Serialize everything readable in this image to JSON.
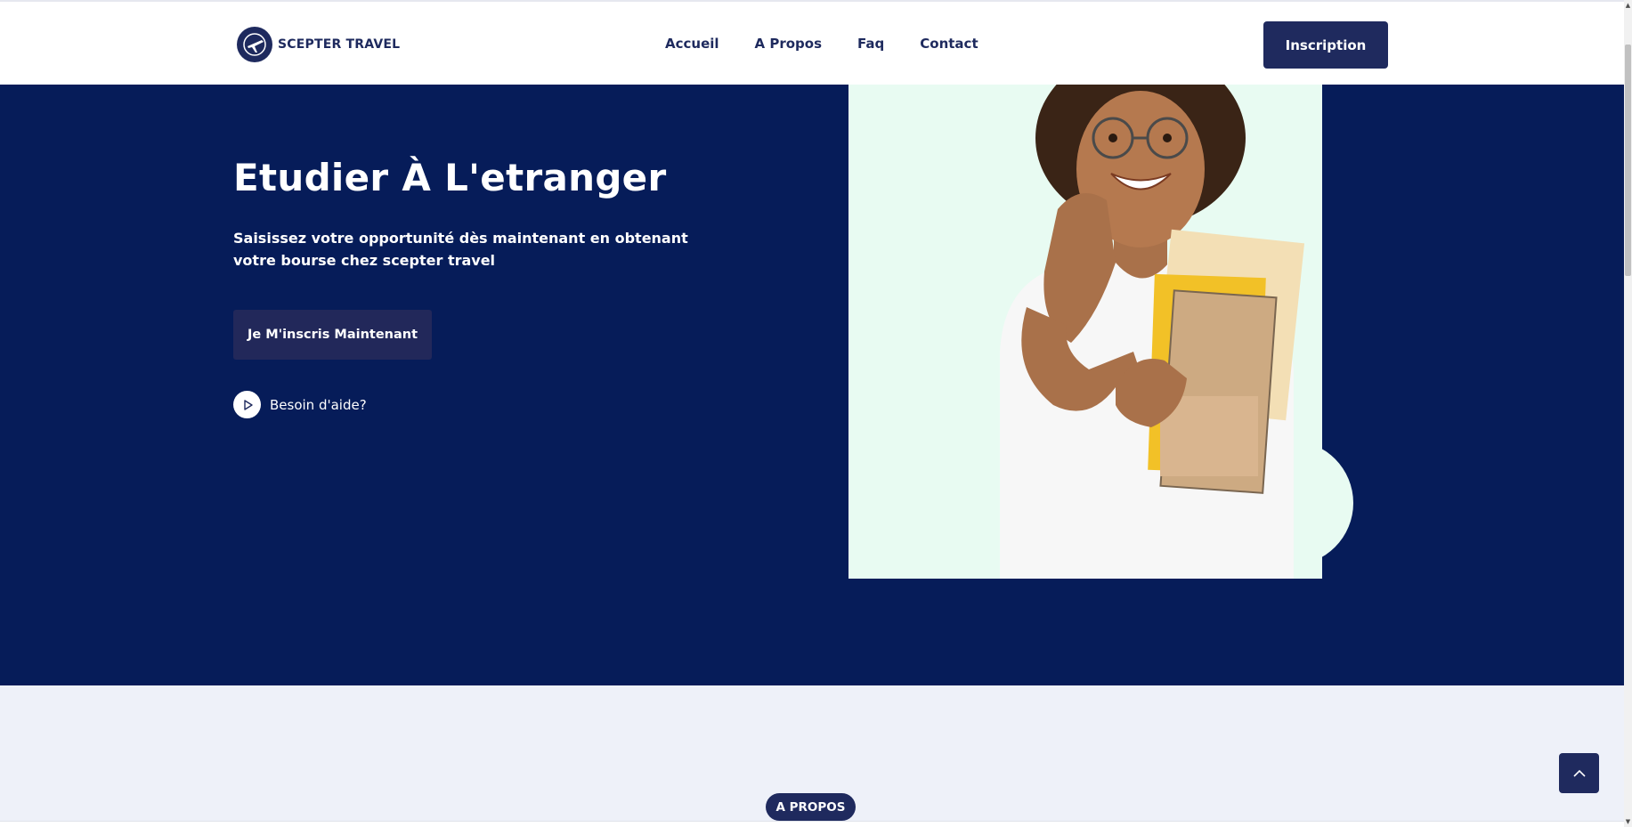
{
  "header": {
    "logo_text": "SCEPTER TRAVEL",
    "nav": [
      {
        "label": "Accueil"
      },
      {
        "label": "A Propos"
      },
      {
        "label": "Faq"
      },
      {
        "label": "Contact"
      }
    ],
    "cta_label": "Inscription"
  },
  "hero": {
    "title": "Etudier À L'etranger",
    "subtitle": "Saisissez votre opportunité dès maintenant en obtenant votre bourse chez scepter travel",
    "button_label": "Je M'inscris Maintenant",
    "help_label": "Besoin d'aide?",
    "image_subject": "smiling student holding notebooks"
  },
  "section": {
    "badge": "A PROPOS"
  },
  "colors": {
    "navy": "#061c59",
    "button": "#1f2a5e",
    "photo_bg": "#e8fbf2",
    "section_bg": "#eef1f9"
  },
  "icons": {
    "logo": "airplane-globe-icon",
    "help": "play-icon",
    "to_top": "chevron-up-icon"
  }
}
